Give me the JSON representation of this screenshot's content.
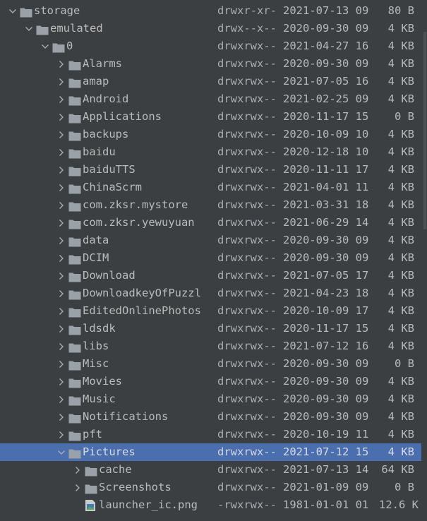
{
  "colors": {
    "background": "#3c3f41",
    "selection": "#4b6eaf",
    "folder": "#9aa1a8",
    "text": "#bbbbbb"
  },
  "rows": [
    {
      "name": "storage",
      "level": 0,
      "type": "folder",
      "state": "expanded",
      "perm": "drwxr-xr-",
      "date": "2021-07-13 09",
      "size": "80 B"
    },
    {
      "name": "emulated",
      "level": 1,
      "type": "folder",
      "state": "expanded",
      "perm": "drwx--x--",
      "date": "2020-09-30 09",
      "size": "4 KB"
    },
    {
      "name": "0",
      "level": 2,
      "type": "folder",
      "state": "expanded",
      "perm": "drwxrwx--",
      "date": "2021-04-27 16",
      "size": "4 KB"
    },
    {
      "name": "Alarms",
      "level": 3,
      "type": "folder",
      "state": "collapsed",
      "perm": "drwxrwx--",
      "date": "2020-09-30 09",
      "size": "4 KB"
    },
    {
      "name": "amap",
      "level": 3,
      "type": "folder",
      "state": "collapsed",
      "perm": "drwxrwx--",
      "date": "2021-07-05 16",
      "size": "4 KB"
    },
    {
      "name": "Android",
      "level": 3,
      "type": "folder",
      "state": "collapsed",
      "perm": "drwxrwx--",
      "date": "2021-02-25 09",
      "size": "4 KB"
    },
    {
      "name": "Applications",
      "level": 3,
      "type": "folder",
      "state": "collapsed",
      "perm": "drwxrwx--",
      "date": "2020-11-17 15",
      "size": "0 B"
    },
    {
      "name": "backups",
      "level": 3,
      "type": "folder",
      "state": "collapsed",
      "perm": "drwxrwx--",
      "date": "2020-10-09 10",
      "size": "4 KB"
    },
    {
      "name": "baidu",
      "level": 3,
      "type": "folder",
      "state": "collapsed",
      "perm": "drwxrwx--",
      "date": "2020-12-18 10",
      "size": "4 KB"
    },
    {
      "name": "baiduTTS",
      "level": 3,
      "type": "folder",
      "state": "collapsed",
      "perm": "drwxrwx--",
      "date": "2020-11-11 17",
      "size": "4 KB"
    },
    {
      "name": "ChinaScrm",
      "level": 3,
      "type": "folder",
      "state": "collapsed",
      "perm": "drwxrwx--",
      "date": "2021-04-01 11",
      "size": "4 KB"
    },
    {
      "name": "com.zksr.mystore",
      "level": 3,
      "type": "folder",
      "state": "collapsed",
      "perm": "drwxrwx--",
      "date": "2021-03-31 18",
      "size": "4 KB"
    },
    {
      "name": "com.zksr.yewuyuan",
      "level": 3,
      "type": "folder",
      "state": "collapsed",
      "perm": "drwxrwx--",
      "date": "2021-06-29 14",
      "size": "4 KB"
    },
    {
      "name": "data",
      "level": 3,
      "type": "folder",
      "state": "collapsed",
      "perm": "drwxrwx--",
      "date": "2020-09-30 09",
      "size": "4 KB"
    },
    {
      "name": "DCIM",
      "level": 3,
      "type": "folder",
      "state": "collapsed",
      "perm": "drwxrwx--",
      "date": "2020-09-30 09",
      "size": "4 KB"
    },
    {
      "name": "Download",
      "level": 3,
      "type": "folder",
      "state": "collapsed",
      "perm": "drwxrwx--",
      "date": "2021-07-05 17",
      "size": "4 KB"
    },
    {
      "name": "DownloadkeyOfPuzzl",
      "level": 3,
      "type": "folder",
      "state": "collapsed",
      "perm": "drwxrwx--",
      "date": "2021-04-23 18",
      "size": "4 KB"
    },
    {
      "name": "EditedOnlinePhotos",
      "level": 3,
      "type": "folder",
      "state": "collapsed",
      "perm": "drwxrwx--",
      "date": "2020-10-09 17",
      "size": "4 KB"
    },
    {
      "name": "ldsdk",
      "level": 3,
      "type": "folder",
      "state": "collapsed",
      "perm": "drwxrwx--",
      "date": "2020-11-17 15",
      "size": "4 KB"
    },
    {
      "name": "libs",
      "level": 3,
      "type": "folder",
      "state": "collapsed",
      "perm": "drwxrwx--",
      "date": "2021-07-12 16",
      "size": "4 KB"
    },
    {
      "name": "Misc",
      "level": 3,
      "type": "folder",
      "state": "collapsed",
      "perm": "drwxrwx--",
      "date": "2020-09-30 09",
      "size": "0 B"
    },
    {
      "name": "Movies",
      "level": 3,
      "type": "folder",
      "state": "collapsed",
      "perm": "drwxrwx--",
      "date": "2020-09-30 09",
      "size": "4 KB"
    },
    {
      "name": "Music",
      "level": 3,
      "type": "folder",
      "state": "collapsed",
      "perm": "drwxrwx--",
      "date": "2020-09-30 09",
      "size": "4 KB"
    },
    {
      "name": "Notifications",
      "level": 3,
      "type": "folder",
      "state": "collapsed",
      "perm": "drwxrwx--",
      "date": "2020-09-30 09",
      "size": "4 KB"
    },
    {
      "name": "pft",
      "level": 3,
      "type": "folder",
      "state": "collapsed",
      "perm": "drwxrwx--",
      "date": "2020-10-19 11",
      "size": "4 KB"
    },
    {
      "name": "Pictures",
      "level": 3,
      "type": "folder",
      "state": "expanded",
      "selected": true,
      "perm": "drwxrwx--",
      "date": "2021-07-12 15",
      "size": "4 KB"
    },
    {
      "name": "cache",
      "level": 4,
      "type": "folder",
      "state": "collapsed",
      "perm": "drwxrwx--",
      "date": "2021-07-13 14",
      "size": "64 KB"
    },
    {
      "name": "Screenshots",
      "level": 4,
      "type": "folder",
      "state": "collapsed",
      "perm": "drwxrwx--",
      "date": "2021-01-09 09",
      "size": "0 B"
    },
    {
      "name": "launcher_ic.png",
      "level": 4,
      "type": "image-file",
      "state": "none",
      "perm": "-rwxrwx--",
      "date": "1981-01-01 01",
      "size": "12.6 K"
    }
  ]
}
